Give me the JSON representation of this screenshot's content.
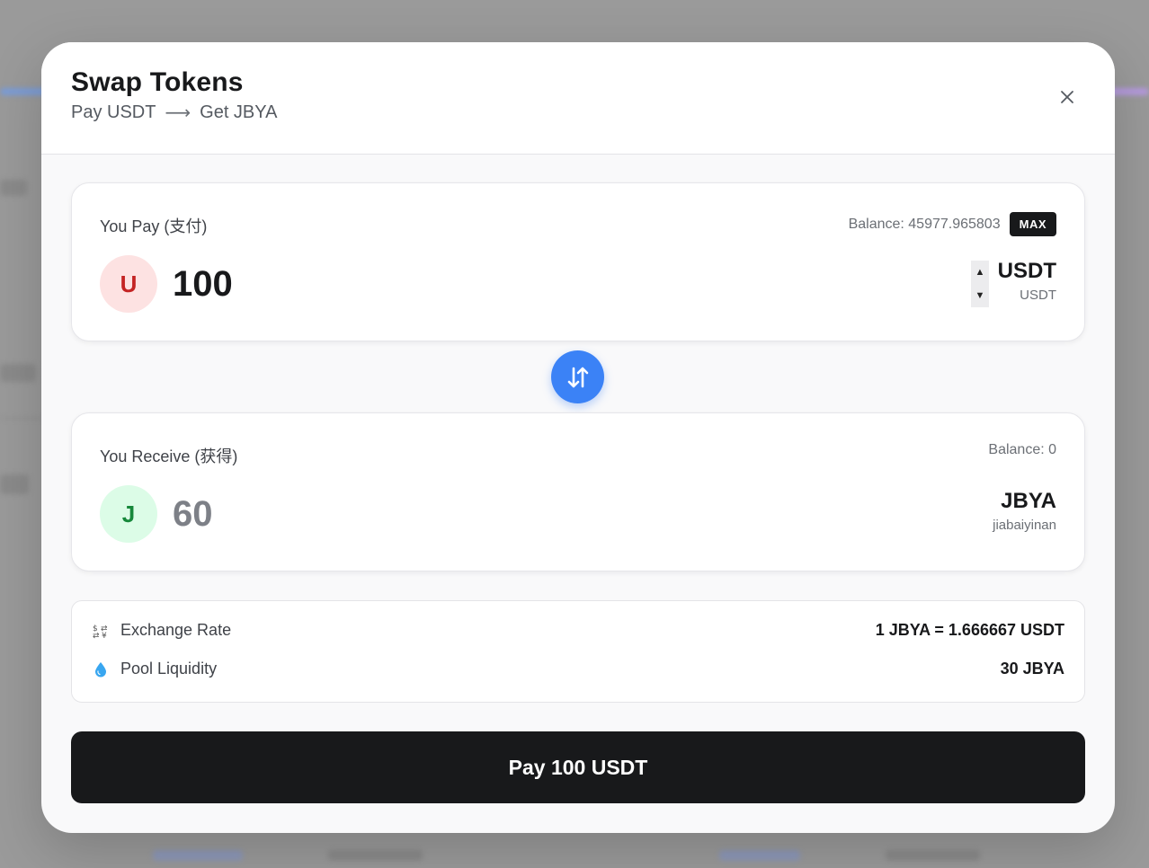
{
  "modal": {
    "title": "Swap Tokens",
    "subtitle_from": "Pay USDT",
    "subtitle_arrow": "⟶",
    "subtitle_to": "Get JBYA"
  },
  "pay": {
    "label": "You Pay (支付)",
    "balance": "Balance: 45977.965803",
    "max_label": "MAX",
    "avatar_letter": "U",
    "amount": "100",
    "token_symbol": "USDT",
    "token_name": "USDT"
  },
  "receive": {
    "label": "You Receive (获得)",
    "balance": "Balance: 0",
    "avatar_letter": "J",
    "amount": "60",
    "token_symbol": "JBYA",
    "token_name": "jiabaiyinan"
  },
  "info": {
    "rate_label": "Exchange Rate",
    "rate_value": "1 JBYA = 1.666667 USDT",
    "liquidity_label": "Pool Liquidity",
    "liquidity_value": "30 JBYA"
  },
  "action": {
    "pay_button": "Pay 100 USDT"
  },
  "colors": {
    "accent": "#3b82f6",
    "primary_button": "#18191b",
    "pay_avatar_bg": "#fde2e2",
    "receive_avatar_bg": "#dcfce7"
  },
  "icons": {
    "close": "close-icon",
    "swap": "swap-arrows-icon",
    "rate": "exchange-rate-icon",
    "liquidity": "droplet-icon"
  }
}
